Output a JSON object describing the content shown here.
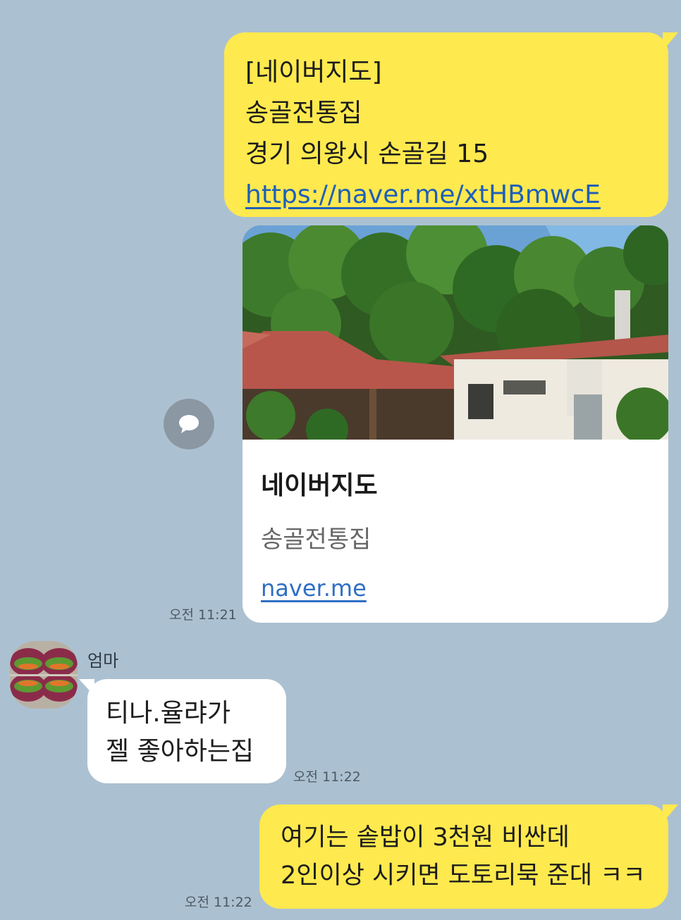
{
  "messages": {
    "map_share": {
      "line1": "[네이버지도]",
      "line2": "송골전통집",
      "line3": "경기 의왕시 손골길 15",
      "link": "https://naver.me/xtHBmwcE"
    },
    "card": {
      "title": "네이버지도",
      "subtitle": "송골전통집",
      "link": "naver.me",
      "image_icon": "restaurant-photo"
    },
    "share_icon": "chat-bubble-icon",
    "time1": "오전 11:21",
    "mom": {
      "sender": "엄마",
      "avatar_icon": "sandwich-photo",
      "line1": "티나.율랴가",
      "line2": "젤 좋아하는집",
      "time": "오전 11:22"
    },
    "reply": {
      "line1": "여기는 솥밥이 3천원 비싼데",
      "line2": "2인이상 시키면 도토리묵 준대 ㅋㅋ",
      "time": "오전 11:22"
    }
  },
  "colors": {
    "background": "#abc1d1",
    "my_bubble": "#fee94e",
    "other_bubble": "#ffffff",
    "link": "#1f5fb8"
  }
}
